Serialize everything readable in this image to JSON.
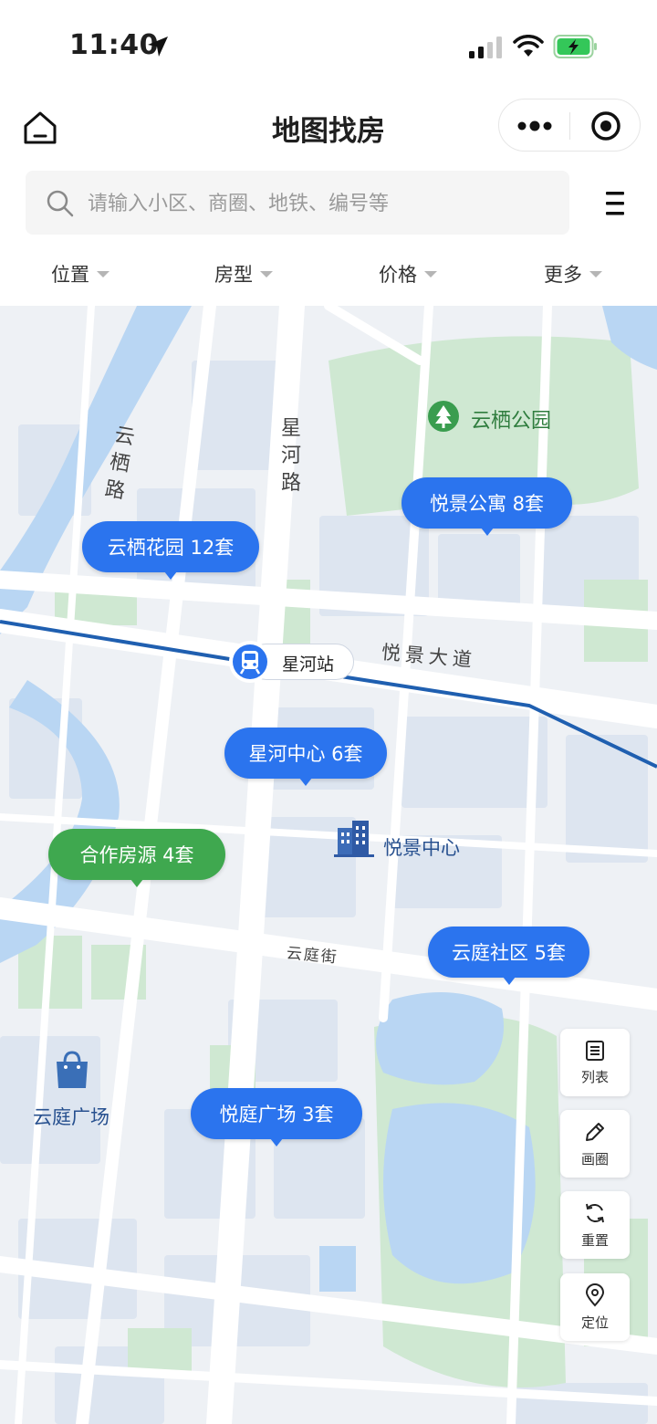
{
  "status_bar": {
    "time": "11:40"
  },
  "title_bar": {
    "title": "地图找房"
  },
  "search": {
    "placeholder": "请输入小区、商圈、地铁、编号等"
  },
  "filters": [
    {
      "label": "位置"
    },
    {
      "label": "房型"
    },
    {
      "label": "价格"
    },
    {
      "label": "更多"
    }
  ],
  "map": {
    "labels": {
      "road_yunqi": "云栖路",
      "road_xinghe": "星河路",
      "road_yuejing": "悦景大道",
      "road_yunting": "云庭街",
      "park": "云栖公园",
      "station": "星河站",
      "building": "悦景中心",
      "mall": "云庭广场"
    },
    "pins": [
      {
        "name": "悦景公寓",
        "count": "8套",
        "text": "悦景公寓 8套",
        "type": "listing"
      },
      {
        "name": "云栖花园",
        "count": "12套",
        "text": "云栖花园 12套",
        "type": "listing"
      },
      {
        "name": "星河中心",
        "count": "6套",
        "text": "星河中心 6套",
        "type": "listing"
      },
      {
        "name": "合作房源",
        "count": "4套",
        "text": "合作房源 4套",
        "type": "partner"
      },
      {
        "name": "云庭社区",
        "count": "5套",
        "text": "云庭社区 5套",
        "type": "listing"
      },
      {
        "name": "悦庭广场",
        "count": "3套",
        "text": "悦庭广场 3套",
        "type": "listing"
      }
    ]
  },
  "tools": [
    {
      "label": "列表",
      "icon": "list-icon"
    },
    {
      "label": "画圈",
      "icon": "pencil-icon"
    },
    {
      "label": "重置",
      "icon": "refresh-icon"
    },
    {
      "label": "定位",
      "icon": "location-pin-icon"
    }
  ],
  "colors": {
    "accent": "#2b74ee",
    "partner": "#3fa84f",
    "metro_line": "#1f5fb0",
    "park": "#3a9d4f"
  }
}
